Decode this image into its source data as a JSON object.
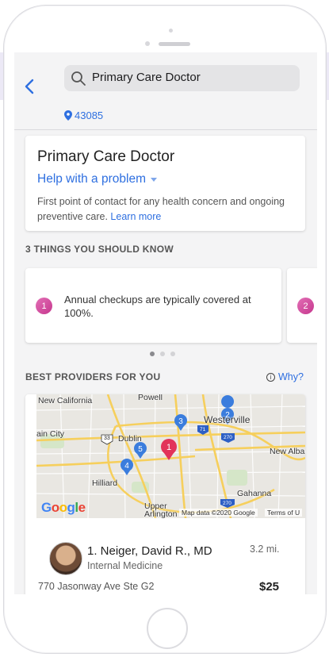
{
  "header": {
    "search_query": "Primary Care Doctor",
    "zip_code": "43085"
  },
  "info_card": {
    "title": "Primary Care Doctor",
    "subtitle": "Help with a problem",
    "description": "First point of contact for any health concern and ongoing preventive care.",
    "learn_more": "Learn more"
  },
  "things": {
    "heading": "3 THINGS YOU SHOULD KNOW",
    "items": [
      {
        "number": "1",
        "text": "Annual checkups are typically covered at 100%."
      },
      {
        "number": "2",
        "text": ""
      }
    ],
    "page_count": 3,
    "active_page": 1
  },
  "providers": {
    "heading": "BEST PROVIDERS FOR YOU",
    "why_label": "Why?",
    "map": {
      "places": [
        "New California",
        "Powell",
        "Westerville",
        "ain City",
        "Dublin",
        "New Alba",
        "Hilliard",
        "Gahanna",
        "Upper Arlington"
      ],
      "highway_shields": [
        "33",
        "71",
        "270",
        "270"
      ],
      "markers": [
        "1",
        "2",
        "3",
        "4",
        "5"
      ],
      "attribution": "Map data ©2020 Google",
      "terms": "Terms of U",
      "logo": "Google"
    },
    "list": [
      {
        "name": "1. Neiger, David R., MD",
        "specialty": "Internal Medicine",
        "distance": "3.2 mi.",
        "address": "770 Jasonway Ave Ste G2",
        "price": "$25"
      }
    ]
  },
  "colors": {
    "accent": "#2e6fe0",
    "marker_blue": "#3b7ddd",
    "marker_red": "#e2335a",
    "badge_pink": "#d04f9e"
  }
}
